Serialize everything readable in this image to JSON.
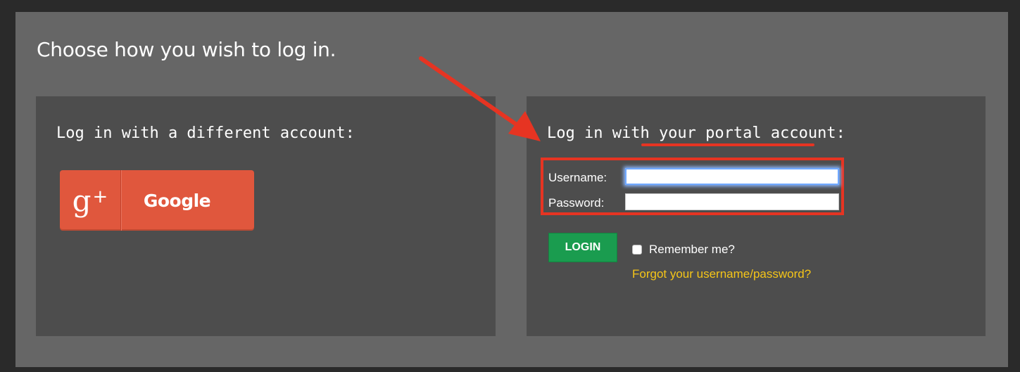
{
  "page": {
    "heading": "Choose how you wish to log in."
  },
  "left_panel": {
    "title": "Log in with a different account:",
    "google_button": {
      "icon": "google-plus-icon",
      "icon_glyph": "g",
      "icon_plus": "+",
      "label": "Google",
      "color": "#e0573d"
    }
  },
  "right_panel": {
    "title": "Log in with your portal account:",
    "username_label": "Username:",
    "username_value": "",
    "password_label": "Password:",
    "password_value": "",
    "login_button": "LOGIN",
    "login_color": "#1a9c4f",
    "remember_label": "Remember me?",
    "remember_checked": false,
    "forgot_link": "Forgot your username/password?",
    "forgot_color": "#f5c518"
  },
  "annotations": {
    "color": "#e63422",
    "arrow": "arrow-pointing-to-portal-login",
    "underline": "underline-your-portal-account",
    "highlight_box": "highlight-credentials-box"
  }
}
